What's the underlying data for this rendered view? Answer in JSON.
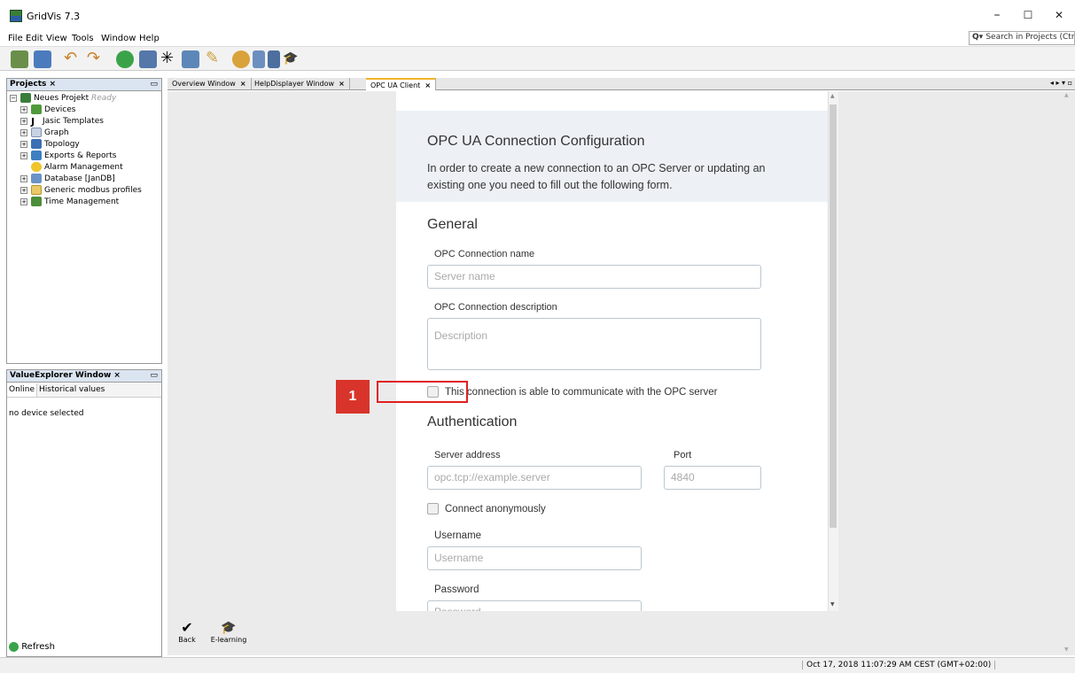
{
  "app": {
    "title": "GridVis 7.3"
  },
  "window_controls": {
    "minimize": "–",
    "maximize": "☐",
    "close": "✕"
  },
  "menu": [
    "File",
    "Edit",
    "View",
    "Tools",
    "Window",
    "Help"
  ],
  "search": {
    "placeholder": "Search in Projects (Ctrl+I)"
  },
  "projects_panel": {
    "title": "Projects",
    "root": {
      "name": "Neues Projekt",
      "status": "Ready"
    },
    "items": [
      "Devices",
      "Jasic Templates",
      "Graph",
      "Topology",
      "Exports & Reports",
      "Alarm Management",
      "Database [JanDB]",
      "Generic modbus profiles",
      "Time Management"
    ]
  },
  "value_explorer": {
    "title": "ValueExplorer Window",
    "tabs": [
      "Online",
      "Historical values"
    ],
    "empty_text": "no device selected",
    "refresh_label": "Refresh"
  },
  "editor_tabs": [
    "Overview Window",
    "HelpDisplayer Window",
    "OPC UA Client"
  ],
  "form": {
    "title": "OPC UA Connection Configuration",
    "description_line1": "In order to create a new connection to an OPC Server or updating an",
    "description_line2": "existing one you need to fill out the following form.",
    "general_heading": "General",
    "name_label": "OPC Connection name",
    "name_placeholder": "Server name",
    "desc_label": "OPC Connection description",
    "desc_placeholder": "Description",
    "communicate_label": "This connection is able to communicate with the OPC server",
    "auth_heading": "Authentication",
    "server_label": "Server address",
    "server_placeholder": "opc.tcp://example.server",
    "port_label": "Port",
    "port_placeholder": "4840",
    "anon_label": "Connect anonymously",
    "username_label": "Username",
    "username_placeholder": "Username",
    "password_label": "Password",
    "password_placeholder": "Password"
  },
  "bottom_actions": {
    "back": "Back",
    "elearning": "E-learning"
  },
  "annotation": {
    "marker": "1"
  },
  "status": {
    "datetime": "Oct 17, 2018 11:07:29 AM CEST (GMT+02:00)"
  }
}
